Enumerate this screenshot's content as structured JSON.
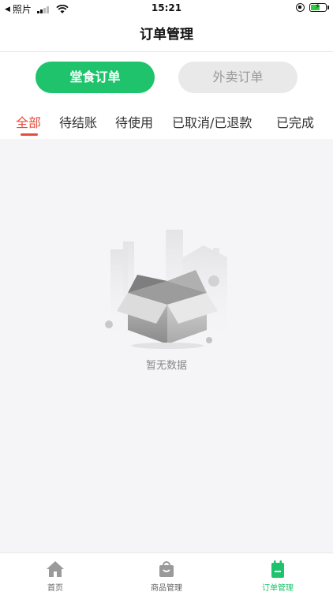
{
  "status_bar": {
    "carrier": "照片",
    "time": "15:21"
  },
  "nav": {
    "title": "订单管理"
  },
  "segment": {
    "dine_in": "堂食订单",
    "takeout": "外卖订单"
  },
  "filters": {
    "all": "全部",
    "pending_payment": "待结账",
    "pending_use": "待使用",
    "cancelled_refunded": "已取消/已退款",
    "completed": "已完成"
  },
  "empty_state": {
    "text": "暂无数据"
  },
  "tabbar": {
    "home": "首页",
    "products": "商品管理",
    "orders": "订单管理"
  },
  "colors": {
    "accent_green": "#1ec36c",
    "active_filter_red": "#e74c3c",
    "inactive_btn_bg": "#e9e9e9"
  },
  "icons": {
    "home": "home-icon",
    "products": "shopping-bag-icon",
    "orders": "clipboard-icon",
    "empty": "empty-box-icon"
  }
}
